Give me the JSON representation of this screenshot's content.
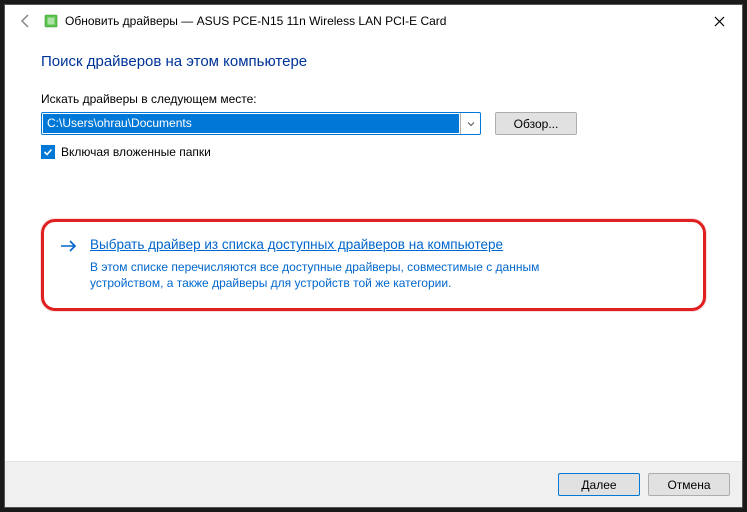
{
  "titlebar": {
    "title": "Обновить драйверы — ASUS PCE-N15 11n Wireless LAN PCI-E Card"
  },
  "content": {
    "heading": "Поиск драйверов на этом компьютере",
    "pathLabel": "Искать драйверы в следующем месте:",
    "pathValue": "C:\\Users\\ohrau\\Documents",
    "browseLabel": "Обзор...",
    "includeSubfoldersLabel": "Включая вложенные папки"
  },
  "option": {
    "title": "Выбрать драйвер из списка доступных драйверов на компьютере",
    "desc": "В этом списке перечисляются все доступные драйверы, совместимые с данным устройством, а также драйверы для устройств той же категории."
  },
  "footer": {
    "next": "Далее",
    "cancel": "Отмена"
  }
}
